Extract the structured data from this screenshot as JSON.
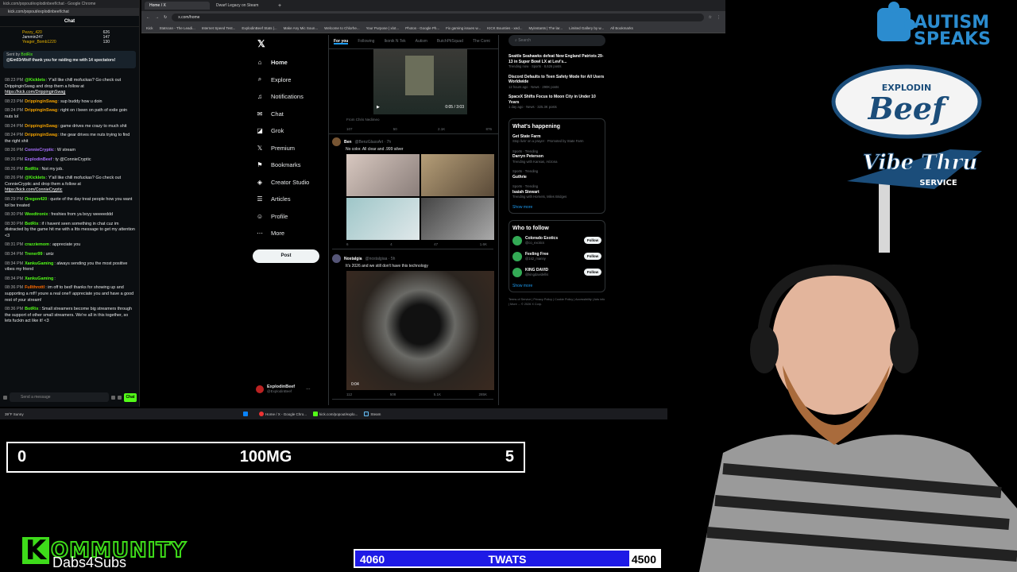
{
  "chat": {
    "window_title": "kick.com/popout/explodinbeef/chat - Google Chrome",
    "url": "kick.com/popout/explodinbeef/chat",
    "header": "Chat",
    "leaderboard": [
      {
        "name": "Pezzy_420",
        "value": "626"
      },
      {
        "name": "Jammin247",
        "value": "147"
      },
      {
        "name": "Yeager_Bomb1220",
        "value": "130"
      }
    ],
    "pinned": {
      "sent_by": "Sent by",
      "author": "BotRix",
      "text": "@Em03rWolf thank you for raiding me with 14 spectators!"
    },
    "messages": [
      {
        "time": "08:23 PM",
        "user": "@Kicklets",
        "color": "#53fc18",
        "text": "Y'all like chill mofuckas? Go check out DrippinginSwag and drop them a follow at",
        "link": "https://kick.com/DrippinginSwag"
      },
      {
        "time": "08:23 PM",
        "user": "DrippinginSwag",
        "color": "#f0a000",
        "text": "sup buddy how u doin"
      },
      {
        "time": "08:24 PM",
        "user": "DrippinginSwag",
        "color": "#f0a000",
        "text": "right on i been on path of exile goin nuts lol"
      },
      {
        "time": "08:24 PM",
        "user": "DrippinginSwag",
        "color": "#f0a000",
        "text": "game drives me crazy to much shit"
      },
      {
        "time": "08:24 PM",
        "user": "DrippinginSwag",
        "color": "#f0a000",
        "text": "the gear drives me nuts trying to find the right shit"
      },
      {
        "time": "08:26 PM",
        "user": "ConnieCryptic",
        "color": "#a970ff",
        "text": "W stream"
      },
      {
        "time": "08:26 PM",
        "user": "ExplodinBeef",
        "color": "#a970ff",
        "text": "ty @ConnieCryptic"
      },
      {
        "time": "08:26 PM",
        "user": "BotRix",
        "color": "#53fc18",
        "text": "Not my job."
      },
      {
        "time": "08:26 PM",
        "user": "@Kicklets",
        "color": "#53fc18",
        "text": "Y'all like chill mofuckas? Go check out ConnieCryptic and drop them a follow at",
        "link": "https://kick.com/ConnieCryptic"
      },
      {
        "time": "08:29 PM",
        "user": "Oregon420",
        "color": "#53fc18",
        "text": "quote of the day treat people how you want tol be treated"
      },
      {
        "time": "08:30 PM",
        "user": "Weedtronix",
        "color": "#53fc18",
        "text": "freshies from ya boyy weeeeddd"
      },
      {
        "time": "08:30 PM",
        "user": "BotRix",
        "color": "#53fc18",
        "text": "if i havent seen something in chat cuz im distracted by the game hit me with a ltts message to get my attention <3"
      },
      {
        "time": "08:31 PM",
        "user": "crazziemom",
        "color": "#53fc18",
        "text": "appreciate you"
      },
      {
        "time": "08:34 PM",
        "user": "Trener99",
        "color": "#53fc18",
        "text": "untz"
      },
      {
        "time": "08:34 PM",
        "user": "XankuGaming",
        "color": "#53fc18",
        "text": "always sending you the most positive vibes my friend"
      },
      {
        "time": "08:34 PM",
        "user": "XankuGaming",
        "color": "#53fc18",
        "text": ""
      },
      {
        "time": "08:36 PM",
        "user": "Fullthrottl",
        "color": "#ff6a00",
        "text": "im off to bed! thanks for showing up and supporting a mf!! youre a real one!! appreciate you and have a good rest of your stream!"
      },
      {
        "time": "08:36 PM",
        "user": "BotRix",
        "color": "#53fc18",
        "text": "Small streamers become big streamers through the support of other small streamers. We're all in this together, so lets fuckin act like it! <3"
      }
    ],
    "input_placeholder": "Send a message",
    "chat_button": "Chat",
    "weather": "39°F Sunny"
  },
  "browser": {
    "tabs": [
      "Home / X",
      "Dwarf Legacy on Steam"
    ],
    "url": "x.com/home",
    "bookmarks": [
      "Kick",
      "Statscan - The Leadi...",
      "Internet Speed Test...",
      "ExplodinBeef Stats |...",
      "Make Any Mic Soun...",
      "Welcome to Chlorhe...",
      "Your Purpose | xlot...",
      "Photos - Google Ph...",
      "Fix gaming issues w...",
      "KICK Bounties - xed...",
      "Myinstants | The lar...",
      "Limited Gallery by w...",
      "All Bookmarks"
    ]
  },
  "x": {
    "nav": [
      {
        "label": "Home",
        "icon": "home-icon"
      },
      {
        "label": "Explore",
        "icon": "search-icon"
      },
      {
        "label": "Notifications",
        "icon": "bell-icon"
      },
      {
        "label": "Chat",
        "icon": "mail-icon"
      },
      {
        "label": "Grok",
        "icon": "grok-icon"
      },
      {
        "label": "Premium",
        "icon": "x-icon"
      },
      {
        "label": "Bookmarks",
        "icon": "bookmark-icon"
      },
      {
        "label": "Creator Studio",
        "icon": "studio-icon"
      },
      {
        "label": "Articles",
        "icon": "article-icon"
      },
      {
        "label": "Profile",
        "icon": "person-icon"
      },
      {
        "label": "More",
        "icon": "more-icon"
      }
    ],
    "post_button": "Post",
    "profile": {
      "name": "ExplodinBeef",
      "handle": "@ExplodinBeef"
    },
    "feed_tabs": [
      "For you",
      "Following",
      "Ikonik N Tek",
      "Autism",
      "ButchPitSquad",
      "The Comi"
    ],
    "video1": {
      "time": "0:05 / 3:03",
      "from": "From Chris Nedimeo"
    },
    "actions1": [
      "107",
      "50",
      "2.1K",
      "876"
    ],
    "tweet2": {
      "name": "Ben",
      "handle": "@BenzGlassArt · 7h",
      "text": "No color. All clear and .999 silver",
      "actions": [
        "6",
        "4",
        "47",
        "1.6K"
      ]
    },
    "tweet3": {
      "name": "Nostalgia",
      "handle": "@nostalgiaa · 5h",
      "text": "It's 2026 and we still don't have this technology",
      "time": "0:04",
      "actions": [
        "112",
        "508",
        "5.1K",
        "285K"
      ]
    },
    "search_placeholder": "Search",
    "news": [
      {
        "title": "Seattle Seahawks defeat New England Patriots 29-13 in Super Bowl LX at Levi's...",
        "meta": "Trending now · Sports · 8,626 posts"
      },
      {
        "title": "Discord Defaults to Teen Safety Mode for All Users Worldwide",
        "meta": "12 hours ago · News · 290K posts"
      },
      {
        "title": "SpaceX Shifts Focus to Moon City in Under 10 Years",
        "meta": "1 day ago · News · 325.3K posts"
      }
    ],
    "whats_happening": "What's happening",
    "trends": [
      {
        "cat": "",
        "name": "Get State Farm",
        "sub": "Stop livin' on a prayer · Promoted by State Farm"
      },
      {
        "cat": "Sports · Trending",
        "name": "Darryn Peterson",
        "sub": "Trending with Kansas, Arizona"
      },
      {
        "cat": "Sports · Trending",
        "name": "Guthrie",
        "sub": ""
      },
      {
        "cat": "Sports · Trending",
        "name": "Isaiah Stewart",
        "sub": "Trending with Hornets, Miles Bridges"
      }
    ],
    "show_more": "Show more",
    "who_to_follow": "Who to follow",
    "follow_suggestions": [
      {
        "name": "Colorado Exotics",
        "handle": "@co_exotics"
      },
      {
        "name": "Feeling Free",
        "handle": "@1s2_manny"
      },
      {
        "name": "KING DAVID",
        "handle": "@kingdavidellis"
      }
    ],
    "follow_label": "Follow",
    "footer": "Terms of Service | Privacy Policy | Cookie Policy | Accessibility | Ads info | More ... © 2026 X Corp."
  },
  "taskbar": {
    "apps": [
      "Home / X - Google Chro...",
      "kick.com/popout/explo...",
      "Steam"
    ]
  },
  "overlay": {
    "counter": {
      "left": "0",
      "middle": "100MG",
      "right": "5"
    },
    "goal": {
      "current": "4060",
      "label": "TWATS",
      "target": "4500",
      "progress": 0.902
    },
    "kommunity": {
      "letter": "K",
      "word": "OMMUNITY",
      "sub": "Dabs4Subs"
    },
    "autism": {
      "line1": "AUTISM",
      "line2": "SPEAKS"
    },
    "beef_logo": {
      "top": "EXPLODIN",
      "big": "Beef",
      "mid": "Vibe Thru",
      "service": "SERVICE"
    }
  },
  "colors": {
    "kick_green": "#53fc18",
    "x_blue": "#1d9bf0",
    "goal_blue": "#1e1ae6",
    "autism_blue": "#2b8ccf"
  }
}
